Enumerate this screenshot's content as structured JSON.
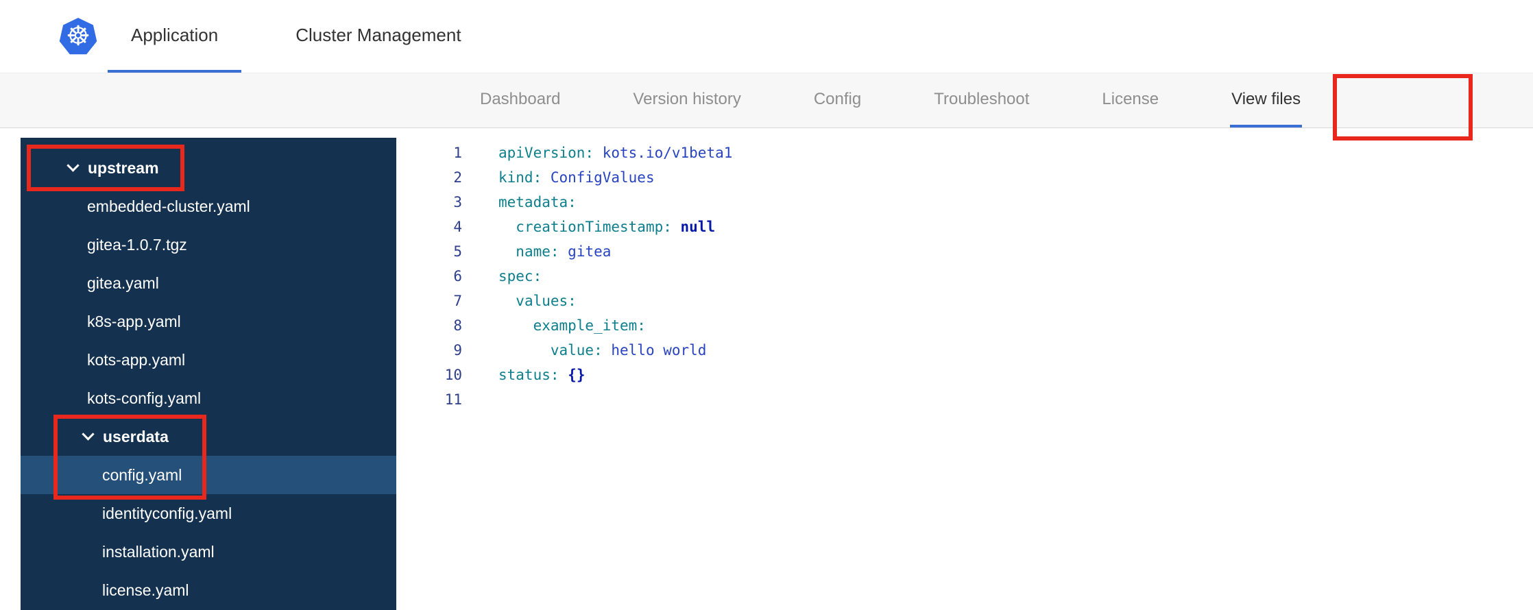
{
  "header": {
    "logo": "kubernetes-logo",
    "tabs": [
      {
        "label": "Application",
        "active": true
      },
      {
        "label": "Cluster Management",
        "active": false
      }
    ]
  },
  "subnav": {
    "items": [
      {
        "label": "Dashboard",
        "active": false
      },
      {
        "label": "Version history",
        "active": false
      },
      {
        "label": "Config",
        "active": false
      },
      {
        "label": "Troubleshoot",
        "active": false
      },
      {
        "label": "License",
        "active": false
      },
      {
        "label": "View files",
        "active": true,
        "annotated": true
      }
    ]
  },
  "file_tree": {
    "items": [
      {
        "label": "upstream",
        "type": "folder",
        "level": 0,
        "expanded": true,
        "annotated": true
      },
      {
        "label": "embedded-cluster.yaml",
        "type": "file",
        "level": 1
      },
      {
        "label": "gitea-1.0.7.tgz",
        "type": "file",
        "level": 1
      },
      {
        "label": "gitea.yaml",
        "type": "file",
        "level": 1
      },
      {
        "label": "k8s-app.yaml",
        "type": "file",
        "level": 1
      },
      {
        "label": "kots-app.yaml",
        "type": "file",
        "level": 1
      },
      {
        "label": "kots-config.yaml",
        "type": "file",
        "level": 1
      },
      {
        "label": "userdata",
        "type": "folder",
        "level": 1,
        "expanded": true,
        "annotated": true
      },
      {
        "label": "config.yaml",
        "type": "file",
        "level": 2,
        "selected": true,
        "annotated": true
      },
      {
        "label": "identityconfig.yaml",
        "type": "file",
        "level": 2
      },
      {
        "label": "installation.yaml",
        "type": "file",
        "level": 2
      },
      {
        "label": "license.yaml",
        "type": "file",
        "level": 2
      }
    ]
  },
  "editor": {
    "lines": [
      {
        "n": "1",
        "tokens": [
          [
            "k",
            "apiVersion:"
          ],
          [
            "p",
            " "
          ],
          [
            "v",
            "kots.io/v1beta1"
          ]
        ]
      },
      {
        "n": "2",
        "tokens": [
          [
            "k",
            "kind:"
          ],
          [
            "p",
            " "
          ],
          [
            "v",
            "ConfigValues"
          ]
        ]
      },
      {
        "n": "3",
        "tokens": [
          [
            "k",
            "metadata:"
          ]
        ]
      },
      {
        "n": "4",
        "tokens": [
          [
            "p",
            "  "
          ],
          [
            "k",
            "creationTimestamp:"
          ],
          [
            "p",
            " "
          ],
          [
            "kw",
            "null"
          ]
        ]
      },
      {
        "n": "5",
        "tokens": [
          [
            "p",
            "  "
          ],
          [
            "k",
            "name:"
          ],
          [
            "p",
            " "
          ],
          [
            "v",
            "gitea"
          ]
        ]
      },
      {
        "n": "6",
        "tokens": [
          [
            "k",
            "spec:"
          ]
        ]
      },
      {
        "n": "7",
        "tokens": [
          [
            "p",
            "  "
          ],
          [
            "k",
            "values:"
          ]
        ]
      },
      {
        "n": "8",
        "tokens": [
          [
            "p",
            "    "
          ],
          [
            "k",
            "example_item:"
          ]
        ]
      },
      {
        "n": "9",
        "tokens": [
          [
            "p",
            "      "
          ],
          [
            "k",
            "value:"
          ],
          [
            "p",
            " "
          ],
          [
            "v",
            "hello world"
          ]
        ]
      },
      {
        "n": "10",
        "tokens": [
          [
            "k",
            "status:"
          ],
          [
            "p",
            " "
          ],
          [
            "kw",
            "{}"
          ]
        ]
      },
      {
        "n": "11",
        "tokens": []
      }
    ]
  },
  "colors": {
    "accent_blue": "#3b6fd4",
    "logo_blue": "#326CE5",
    "annotation_red": "#e8281d",
    "sidebar_bg": "#14324f",
    "sidebar_selected_bg": "#25507a",
    "code_key": "#0d7f8c",
    "code_value": "#2843c0",
    "code_keyword": "#0518a8",
    "line_number": "#2d3e8b"
  }
}
